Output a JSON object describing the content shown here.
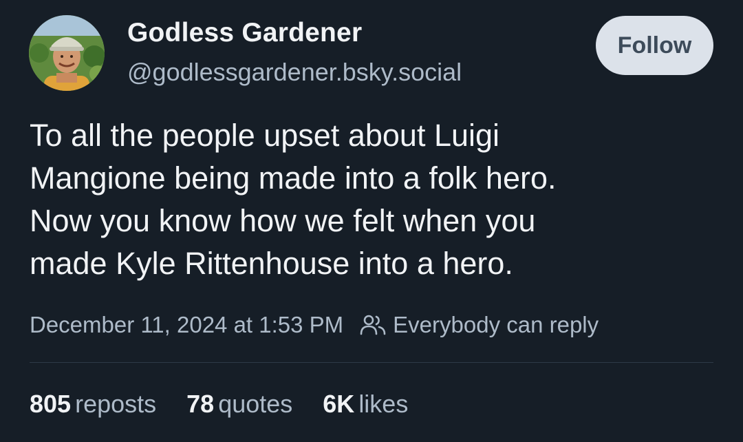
{
  "author": {
    "display_name": "Godless Gardener",
    "handle": "@godlessgardener.bsky.social",
    "avatar": "avatar-photo-icon"
  },
  "follow_label": "Follow",
  "post": {
    "text": "To all the people upset about Luigi\nMangione being made into a folk hero.\nNow you know how we felt when you\nmade Kyle Rittenhouse into a hero.",
    "timestamp": "December 11, 2024 at 1:53 PM",
    "reply_setting": "Everybody can reply"
  },
  "stats": [
    {
      "count": "805",
      "label": "reposts"
    },
    {
      "count": "78",
      "label": "quotes"
    },
    {
      "count": "6K",
      "label": "likes"
    }
  ],
  "colors": {
    "background": "#161e27",
    "text": "#f1f3f5",
    "muted": "#aebbc9",
    "button_bg": "#dce2ea",
    "button_text": "#3d4b5a"
  }
}
